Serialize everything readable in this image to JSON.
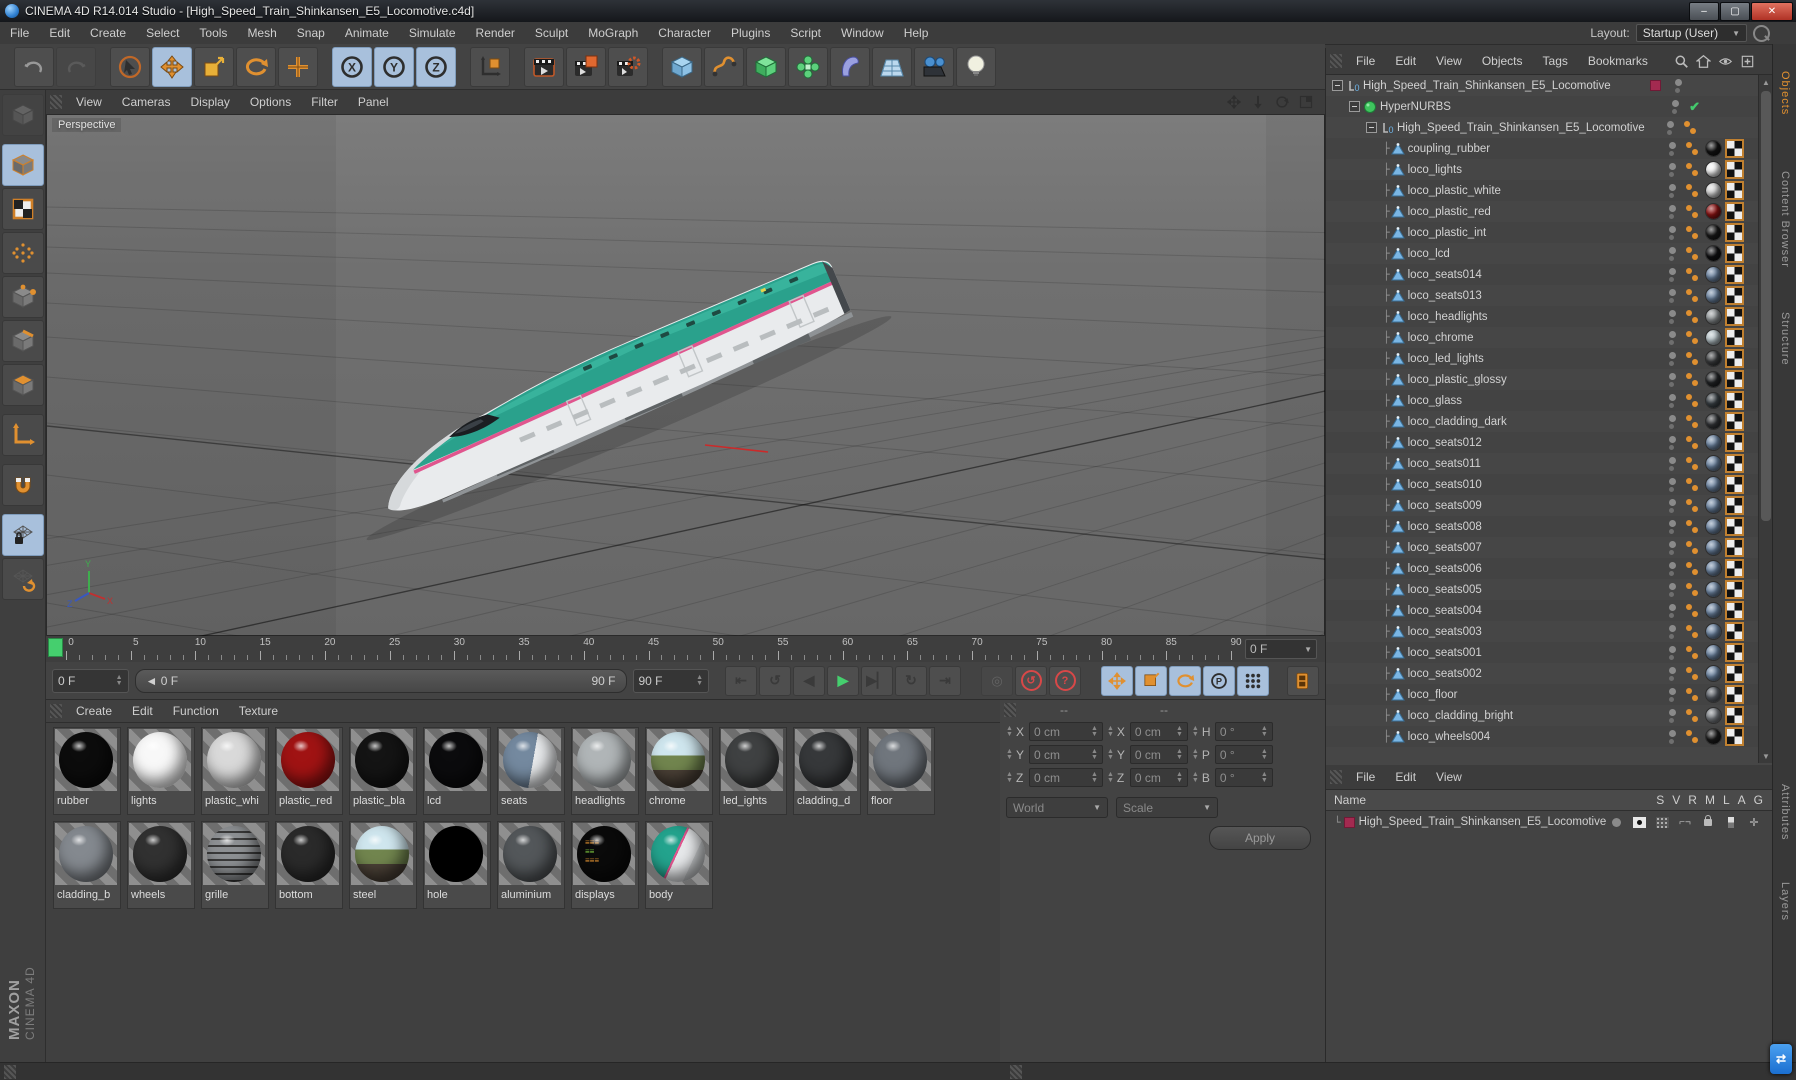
{
  "window": {
    "title": "CINEMA 4D R14.014 Studio - [High_Speed_Train_Shinkansen_E5_Locomotive.c4d]",
    "minimize": "–",
    "maximize": "▢",
    "close": "✕"
  },
  "menubar": {
    "items": [
      "File",
      "Edit",
      "Create",
      "Select",
      "Tools",
      "Mesh",
      "Snap",
      "Animate",
      "Simulate",
      "Render",
      "Sculpt",
      "MoGraph",
      "Character",
      "Plugins",
      "Script",
      "Window",
      "Help"
    ],
    "layout_label": "Layout:",
    "layout_value": "Startup (User)"
  },
  "toolbar": {
    "tools": [
      {
        "icon": "undo",
        "state": "normal"
      },
      {
        "icon": "redo",
        "state": "disabled"
      },
      {
        "icon": "live-selection",
        "state": "normal"
      },
      {
        "icon": "move",
        "state": "active"
      },
      {
        "icon": "scale",
        "state": "normal"
      },
      {
        "icon": "rotate",
        "state": "normal"
      },
      {
        "icon": "last-tool",
        "state": "normal"
      },
      {
        "icon": "lock-x",
        "state": "active",
        "letter": "X"
      },
      {
        "icon": "lock-y",
        "state": "active",
        "letter": "Y"
      },
      {
        "icon": "lock-z",
        "state": "active",
        "letter": "Z"
      },
      {
        "icon": "coordinate-system",
        "state": "normal"
      },
      {
        "icon": "render-view",
        "state": "normal"
      },
      {
        "icon": "render-picture-viewer",
        "state": "normal"
      },
      {
        "icon": "render-settings",
        "state": "normal"
      },
      {
        "icon": "add-primitive",
        "state": "normal"
      },
      {
        "icon": "add-spline",
        "state": "normal"
      },
      {
        "icon": "add-hypernurbs",
        "state": "normal"
      },
      {
        "icon": "add-array",
        "state": "normal"
      },
      {
        "icon": "add-deformer",
        "state": "normal"
      },
      {
        "icon": "add-environment",
        "state": "normal"
      },
      {
        "icon": "add-camera",
        "state": "normal"
      },
      {
        "icon": "add-light",
        "state": "normal"
      }
    ]
  },
  "left_dock": {
    "tools": [
      {
        "icon": "make-editable",
        "state": "disabled"
      },
      {
        "icon": "model-mode",
        "state": "active"
      },
      {
        "icon": "texture-mode",
        "state": "normal"
      },
      {
        "icon": "uv-mode",
        "state": "normal"
      },
      {
        "icon": "points-mode",
        "state": "normal"
      },
      {
        "icon": "edges-mode",
        "state": "normal"
      },
      {
        "icon": "polygons-mode",
        "state": "normal"
      },
      {
        "icon": "axis-mode",
        "state": "normal"
      },
      {
        "icon": "snap-settings",
        "state": "normal"
      },
      {
        "icon": "lock-workplane",
        "state": "active"
      },
      {
        "icon": "planar-workplane",
        "state": "normal"
      }
    ]
  },
  "viewport": {
    "menu": [
      "View",
      "Cameras",
      "Display",
      "Options",
      "Filter",
      "Panel"
    ],
    "label": "Perspective",
    "nav_icons": [
      "pan-icon",
      "dolly-icon",
      "orbit-icon",
      "toggle-view-icon"
    ],
    "axis_labels": {
      "x": "X",
      "y": "Y",
      "z": "Z"
    }
  },
  "timeline": {
    "tick_labels": [
      "0",
      "5",
      "10",
      "15",
      "20",
      "25",
      "30",
      "35",
      "40",
      "45",
      "50",
      "55",
      "60",
      "65",
      "70",
      "75",
      "80",
      "85",
      "90"
    ],
    "frame_count": 90,
    "ruler_field": "0 F",
    "current": "0 F",
    "slider_label": "◄ 0 F",
    "slider_end": "90 F",
    "end": "90 F"
  },
  "transport": {
    "buttons": [
      "goto-start",
      "play-backwards",
      "prev-frame",
      "play",
      "next-frame",
      "loop",
      "goto-end"
    ],
    "record_buttons": [
      "record-options",
      "autokey-record",
      "keyframe-selection"
    ],
    "key_toggles": [
      "key-position",
      "key-scale",
      "key-rotation",
      "key-parameter",
      "key-pla"
    ],
    "open_timeline": "timeline-window"
  },
  "materials": {
    "menu": [
      "Create",
      "Edit",
      "Function",
      "Texture"
    ],
    "row1": [
      {
        "label": "rubber",
        "color": "#0c0c0c",
        "kind": "plain"
      },
      {
        "label": "lights",
        "color": "#f8f8f8",
        "kind": "plain"
      },
      {
        "label": "plastic_whi",
        "color": "#d9d9d9",
        "kind": "plain"
      },
      {
        "label": "plastic_red",
        "color": "#a01313",
        "kind": "plain"
      },
      {
        "label": "plastic_bla",
        "color": "#141414",
        "kind": "plain"
      },
      {
        "label": "lcd",
        "color": "#0b0b0d",
        "kind": "plain"
      },
      {
        "label": "seats",
        "color": "#74899f",
        "kind": "seats"
      },
      {
        "label": "headlights",
        "color": "#b0b5b7",
        "kind": "glassy"
      },
      {
        "label": "chrome",
        "color": "#8fa882",
        "kind": "env"
      },
      {
        "label": "led_ights",
        "color": "#3f4142",
        "kind": "plain"
      },
      {
        "label": "cladding_d",
        "color": "#36383a",
        "kind": "plain"
      },
      {
        "label": "floor",
        "color": "#70767d",
        "kind": "plain"
      },
      {
        "label": "cladding_b",
        "color": "#84898f",
        "kind": "plain"
      }
    ],
    "row2": [
      {
        "label": "wheels",
        "color": "#313131",
        "kind": "plain"
      },
      {
        "label": "grille",
        "color": "#8d9093",
        "kind": "grid"
      },
      {
        "label": "bottom",
        "color": "#2a2a2a",
        "kind": "plain"
      },
      {
        "label": "steel",
        "color": "#c2cbd0",
        "kind": "env"
      },
      {
        "label": "hole",
        "color": "#000000",
        "kind": "flat"
      },
      {
        "label": "aluminium",
        "color": "#53575a",
        "kind": "plain"
      },
      {
        "label": "displays",
        "color": "#0a0a0a",
        "kind": "display"
      },
      {
        "label": "body",
        "color": "#23a38d",
        "kind": "body"
      }
    ]
  },
  "coordinates": {
    "header_left": "--",
    "header_mid": "--",
    "rows": [
      {
        "c1l": "X",
        "c1v": "0 cm",
        "c2l": "X",
        "c2v": "0 cm",
        "c3l": "H",
        "c3v": "0 °"
      },
      {
        "c1l": "Y",
        "c1v": "0 cm",
        "c2l": "Y",
        "c2v": "0 cm",
        "c3l": "P",
        "c3v": "0 °"
      },
      {
        "c1l": "Z",
        "c1v": "0 cm",
        "c2l": "Z",
        "c2v": "0 cm",
        "c3l": "B",
        "c3v": "0 °"
      }
    ],
    "system": "World",
    "mode": "Scale",
    "apply": "Apply"
  },
  "object_manager": {
    "menu": [
      "File",
      "Edit",
      "View",
      "Objects",
      "Tags",
      "Bookmarks"
    ],
    "corner_icons": [
      "search-icon",
      "home-icon",
      "filter-icon",
      "add-layer-icon"
    ],
    "items": [
      {
        "label": "High_Speed_Train_Shinkansen_E5_Locomotive",
        "depth": 0,
        "icon": "null-object",
        "tags": "layer"
      },
      {
        "label": "HyperNURBS",
        "depth": 1,
        "icon": "hypernurbs",
        "tags": "check"
      },
      {
        "label": "High_Speed_Train_Shinkansen_E5_Locomotive",
        "depth": 2,
        "icon": "null-object",
        "tags": "phong"
      },
      {
        "label": "coupling_rubber",
        "depth": 3,
        "icon": "polygon",
        "tags": "mat",
        "mat": "#141414"
      },
      {
        "label": "loco_lights",
        "depth": 3,
        "icon": "polygon",
        "tags": "mat",
        "mat": "#f2f2f2"
      },
      {
        "label": "loco_plastic_white",
        "depth": 3,
        "icon": "polygon",
        "tags": "mat",
        "mat": "#d6d6d6"
      },
      {
        "label": "loco_plastic_red",
        "depth": 3,
        "icon": "polygon",
        "tags": "mat",
        "mat": "#8e1414"
      },
      {
        "label": "loco_plastic_int",
        "depth": 3,
        "icon": "polygon",
        "tags": "mat",
        "mat": "#1a1a1a"
      },
      {
        "label": "loco_lcd",
        "depth": 3,
        "icon": "polygon",
        "tags": "mat",
        "mat": "#101012"
      },
      {
        "label": "loco_seats014",
        "depth": 3,
        "icon": "polygon",
        "tags": "mat",
        "mat": "#6f87a4"
      },
      {
        "label": "loco_seats013",
        "depth": 3,
        "icon": "polygon",
        "tags": "mat",
        "mat": "#6f87a4"
      },
      {
        "label": "loco_headlights",
        "depth": 3,
        "icon": "polygon",
        "tags": "mat",
        "mat": "#94999b"
      },
      {
        "label": "loco_chrome",
        "depth": 3,
        "icon": "polygon",
        "tags": "mat",
        "mat": "#b9c6cb"
      },
      {
        "label": "loco_led_lights",
        "depth": 3,
        "icon": "polygon",
        "tags": "mat",
        "mat": "#3e4042"
      },
      {
        "label": "loco_plastic_glossy",
        "depth": 3,
        "icon": "polygon",
        "tags": "mat",
        "mat": "#242628"
      },
      {
        "label": "loco_glass",
        "depth": 3,
        "icon": "polygon",
        "tags": "mat",
        "mat": "#3d4449"
      },
      {
        "label": "loco_cladding_dark",
        "depth": 3,
        "icon": "polygon",
        "tags": "mat",
        "mat": "#35373a"
      },
      {
        "label": "loco_seats012",
        "depth": 3,
        "icon": "polygon",
        "tags": "mat",
        "mat": "#6f87a4"
      },
      {
        "label": "loco_seats011",
        "depth": 3,
        "icon": "polygon",
        "tags": "mat",
        "mat": "#6f87a4"
      },
      {
        "label": "loco_seats010",
        "depth": 3,
        "icon": "polygon",
        "tags": "mat",
        "mat": "#6f87a4"
      },
      {
        "label": "loco_seats009",
        "depth": 3,
        "icon": "polygon",
        "tags": "mat",
        "mat": "#6f87a4"
      },
      {
        "label": "loco_seats008",
        "depth": 3,
        "icon": "polygon",
        "tags": "mat",
        "mat": "#6f87a4"
      },
      {
        "label": "loco_seats007",
        "depth": 3,
        "icon": "polygon",
        "tags": "mat",
        "mat": "#6f87a4"
      },
      {
        "label": "loco_seats006",
        "depth": 3,
        "icon": "polygon",
        "tags": "mat",
        "mat": "#6f87a4"
      },
      {
        "label": "loco_seats005",
        "depth": 3,
        "icon": "polygon",
        "tags": "mat",
        "mat": "#6f87a4"
      },
      {
        "label": "loco_seats004",
        "depth": 3,
        "icon": "polygon",
        "tags": "mat",
        "mat": "#6f87a4"
      },
      {
        "label": "loco_seats003",
        "depth": 3,
        "icon": "polygon",
        "tags": "mat",
        "mat": "#6f87a4"
      },
      {
        "label": "loco_seats001",
        "depth": 3,
        "icon": "polygon",
        "tags": "mat",
        "mat": "#6f87a4"
      },
      {
        "label": "loco_seats002",
        "depth": 3,
        "icon": "polygon",
        "tags": "mat",
        "mat": "#6f87a4"
      },
      {
        "label": "loco_floor",
        "depth": 3,
        "icon": "polygon",
        "tags": "mat",
        "mat": "#5c6168"
      },
      {
        "label": "loco_cladding_bright",
        "depth": 3,
        "icon": "polygon",
        "tags": "mat",
        "mat": "#7d8186"
      },
      {
        "label": "loco_wheels004",
        "depth": 3,
        "icon": "polygon",
        "tags": "mat",
        "mat": "#1b1b1b"
      }
    ]
  },
  "basic_manager": {
    "menu": [
      "File",
      "Edit",
      "View"
    ],
    "name_header": "Name",
    "columns": [
      "S",
      "V",
      "R",
      "M",
      "L",
      "A",
      "G"
    ],
    "row_name": "High_Speed_Train_Shinkansen_E5_Locomotive"
  },
  "side_tabs": {
    "top": [
      {
        "label": "Objects",
        "active": true
      },
      {
        "label": "Content Browser",
        "active": false
      },
      {
        "label": "Structure",
        "active": false
      }
    ],
    "bottom": [
      {
        "label": "Attributes",
        "active": false
      },
      {
        "label": "Layers",
        "active": false
      }
    ]
  },
  "branding": {
    "maxon": "MAXON",
    "cinema": "CINEMA 4D"
  }
}
